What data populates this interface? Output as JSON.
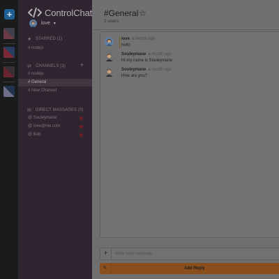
{
  "rail": {
    "add_label": "+",
    "workspaces": [
      {
        "icon": "pink-triangle-workspace-icon",
        "colors": [
          "#6a3a45",
          "#3e3f4a"
        ]
      },
      {
        "icon": "red-blue-triangle-workspace-icon",
        "colors": [
          "#7a2a35",
          "#273b63"
        ]
      },
      {
        "icon": "maroon-triangle-workspace-icon",
        "colors": [
          "#6b2530",
          "#3b2f36"
        ]
      },
      {
        "icon": "lilac-triangle-workspace-icon",
        "colors": [
          "#6f7088",
          "#22334f"
        ]
      }
    ]
  },
  "sidebar": {
    "brand": "ControlChat",
    "user": {
      "name": "love",
      "caret": "▾"
    },
    "starred": {
      "title": "STARRED (1)",
      "items": [
        "# nodejs"
      ]
    },
    "channels": {
      "title": "CHANNELS (3)",
      "add": "+",
      "items": [
        "# nodejs",
        "# General",
        "# New Channel"
      ],
      "active_index": 1
    },
    "direct": {
      "title": "DIRECT MASSAGES (3)",
      "items": [
        "@ Souleymane",
        "@ love@me.com",
        "@ Bob"
      ]
    }
  },
  "header": {
    "title": "#General",
    "star": "☆",
    "subtitle": "2 users"
  },
  "messages": [
    {
      "name": "love",
      "time": "a month ago",
      "text": "hello",
      "avatar": "woman-avatar-icon",
      "highlight": true
    },
    {
      "name": "Souleymane",
      "time": "a month ago",
      "text": "Hi my name is Souleymane",
      "avatar": "man-avatar-icon",
      "highlight": false
    },
    {
      "name": "Souleymane",
      "time": "a month ago",
      "text": "How are you?",
      "avatar": "man-avatar-icon",
      "highlight": false
    }
  ],
  "composer": {
    "plus": "+",
    "placeholder": "Write your message"
  },
  "reply": {
    "label": "Add Reply"
  },
  "colors": {
    "sidebar": "#2f2530",
    "accent": "#8b4e1d",
    "rail_add": "#1f5f93",
    "status_dot": "#6f1f23"
  }
}
